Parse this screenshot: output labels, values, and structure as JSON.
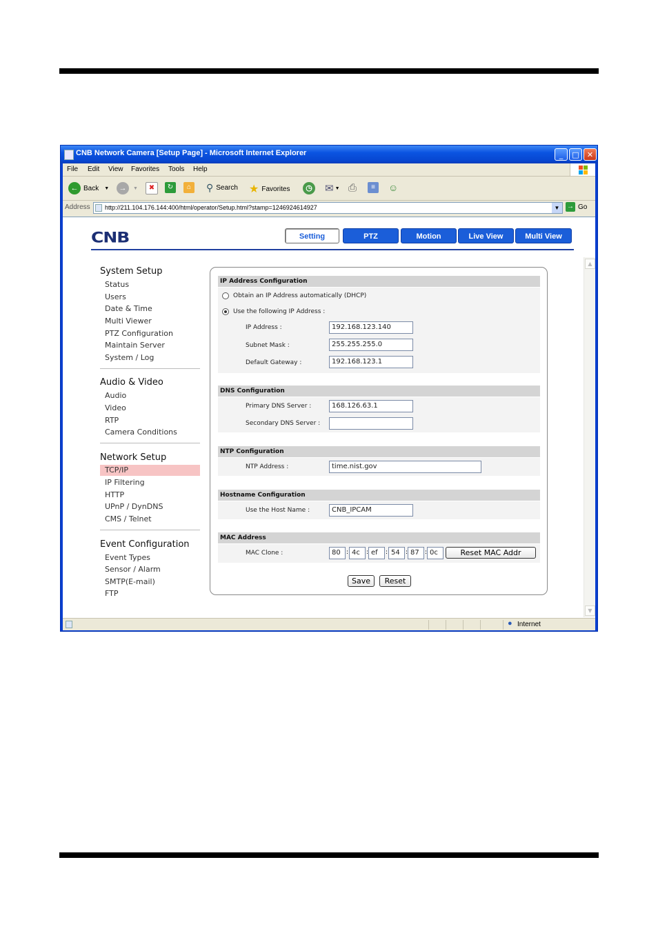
{
  "window": {
    "title": "CNB Network Camera [Setup Page] - Microsoft Internet Explorer",
    "menu": [
      "File",
      "Edit",
      "View",
      "Favorites",
      "Tools",
      "Help"
    ],
    "toolbar": {
      "back": "Back",
      "search": "Search",
      "favorites": "Favorites"
    },
    "address_label": "Address",
    "url": "http://211.104.176.144:400/html/operator/Setup.html?stamp=1246924614927",
    "go": "Go",
    "status_zone": "Internet"
  },
  "header": {
    "logo": "CNB",
    "tabs": [
      "Setting",
      "PTZ",
      "Motion",
      "Live View",
      "Multi View"
    ],
    "active_tab": "Setting"
  },
  "sidebar": {
    "system_setup": {
      "title": "System Setup",
      "items": [
        "Status",
        "Users",
        "Date & Time",
        "Multi Viewer",
        "PTZ Configuration",
        "Maintain Server",
        "System / Log"
      ]
    },
    "audio_video": {
      "title": "Audio & Video",
      "items": [
        "Audio",
        "Video",
        "RTP",
        "Camera Conditions"
      ]
    },
    "network_setup": {
      "title": "Network Setup",
      "items": [
        "TCP/IP",
        "IP Filtering",
        "HTTP",
        "UPnP / DynDNS",
        "CMS / Telnet"
      ]
    },
    "event_config": {
      "title": "Event Configuration",
      "items": [
        "Event Types",
        "Sensor / Alarm",
        "SMTP(E-mail)",
        "FTP"
      ]
    },
    "selected": "TCP/IP"
  },
  "ip_config": {
    "title": "IP Address Configuration",
    "dhcp_label": "Obtain an IP Address automatically (DHCP)",
    "static_label": "Use the following IP Address :",
    "mode": "static",
    "ip_label": "IP Address :",
    "ip": "192.168.123.140",
    "mask_label": "Subnet Mask :",
    "mask": "255.255.255.0",
    "gw_label": "Default Gateway :",
    "gw": "192.168.123.1"
  },
  "dns_config": {
    "title": "DNS Configuration",
    "primary_label": "Primary DNS Server :",
    "primary": "168.126.63.1",
    "secondary_label": "Secondary DNS Server :",
    "secondary": ""
  },
  "ntp_config": {
    "title": "NTP Configuration",
    "label": "NTP Address :",
    "value": "time.nist.gov"
  },
  "hostname_config": {
    "title": "Hostname Configuration",
    "label": "Use the Host Name :",
    "value": "CNB_IPCAM"
  },
  "mac": {
    "title": "MAC Address",
    "label": "MAC Clone :",
    "octets": [
      "80",
      "4c",
      "ef",
      "54",
      "87",
      "0c"
    ],
    "reset_label": "Reset MAC Addr"
  },
  "actions": {
    "save": "Save",
    "reset": "Reset"
  }
}
